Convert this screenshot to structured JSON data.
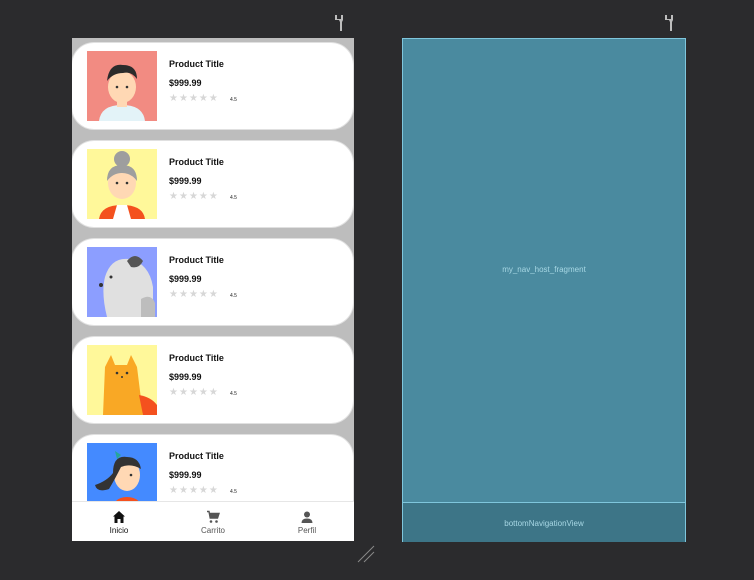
{
  "products": [
    {
      "title": "Product Title",
      "price": "$999.99",
      "rating": "4.5",
      "image": "avatar-boy"
    },
    {
      "title": "Product Title",
      "price": "$999.99",
      "rating": "4.5",
      "image": "avatar-grandma"
    },
    {
      "title": "Product Title",
      "price": "$999.99",
      "rating": "4.5",
      "image": "avatar-dog"
    },
    {
      "title": "Product Title",
      "price": "$999.99",
      "rating": "4.5",
      "image": "avatar-cat"
    },
    {
      "title": "Product Title",
      "price": "$999.99",
      "rating": "4.5",
      "image": "avatar-girl"
    }
  ],
  "nav": {
    "items": [
      {
        "label": "Inicio",
        "icon": "home-icon"
      },
      {
        "label": "Carrito",
        "icon": "cart-icon"
      },
      {
        "label": "Perfil",
        "icon": "person-icon"
      }
    ]
  },
  "blueprint": {
    "host_label": "my_nav_host_fragment",
    "bottom_label": "bottomNavigationView"
  },
  "colors": {
    "canvas": "#2b2b2d",
    "blueprint": "#4a8a9f",
    "blueprint_border": "#7fc6dc"
  }
}
